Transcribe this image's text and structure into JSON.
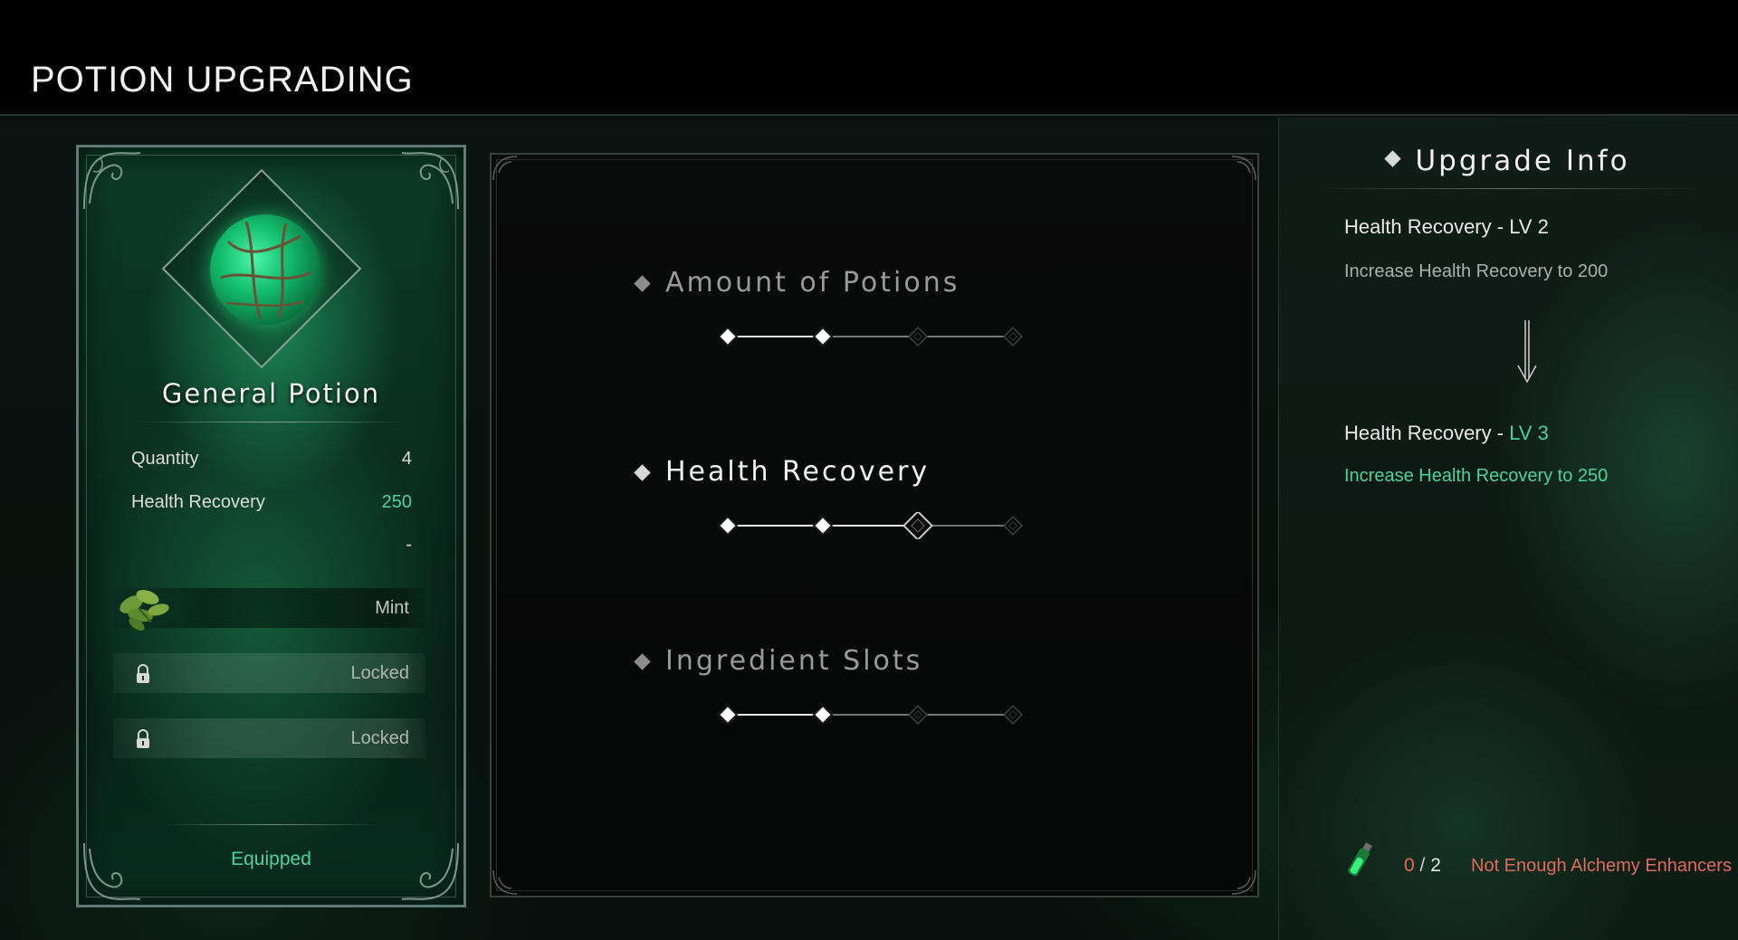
{
  "header": {
    "title": "POTION UPGRADING"
  },
  "potion_card": {
    "name": "General Potion",
    "stats": [
      {
        "label": "Quantity",
        "value": "4"
      },
      {
        "label": "Health Recovery",
        "value": "250"
      },
      {
        "label": "",
        "value": "-"
      }
    ],
    "slots": [
      {
        "label": "Mint",
        "icon": "mint-leaf-icon"
      },
      {
        "label": "Locked",
        "icon": "lock-icon"
      },
      {
        "label": "Locked",
        "icon": "lock-icon"
      }
    ],
    "status": "Equipped"
  },
  "upgrades": [
    {
      "title": "Amount of Potions",
      "level": 2,
      "max": 4,
      "active": false
    },
    {
      "title": "Health Recovery",
      "level": 2,
      "max": 4,
      "active": true,
      "selected_node": 3
    },
    {
      "title": "Ingredient Slots",
      "level": 2,
      "max": 4,
      "active": false
    }
  ],
  "upgrade_info": {
    "title": "Upgrade Info",
    "current_name": "Health Recovery - ",
    "current_level": "LV 2",
    "current_desc": "Increase Health Recovery to 200",
    "next_name": "Health Recovery - ",
    "next_level": "LV 3",
    "next_desc": "Increase Health Recovery to 250"
  },
  "cost": {
    "have": "0",
    "separator": "/",
    "need": "2",
    "message": "Not Enough Alchemy Enhancers",
    "icon": "alchemy-enhancer-vial-icon"
  },
  "colors": {
    "accent_green": "#4ad39a",
    "warning_red": "#e06a5c"
  }
}
